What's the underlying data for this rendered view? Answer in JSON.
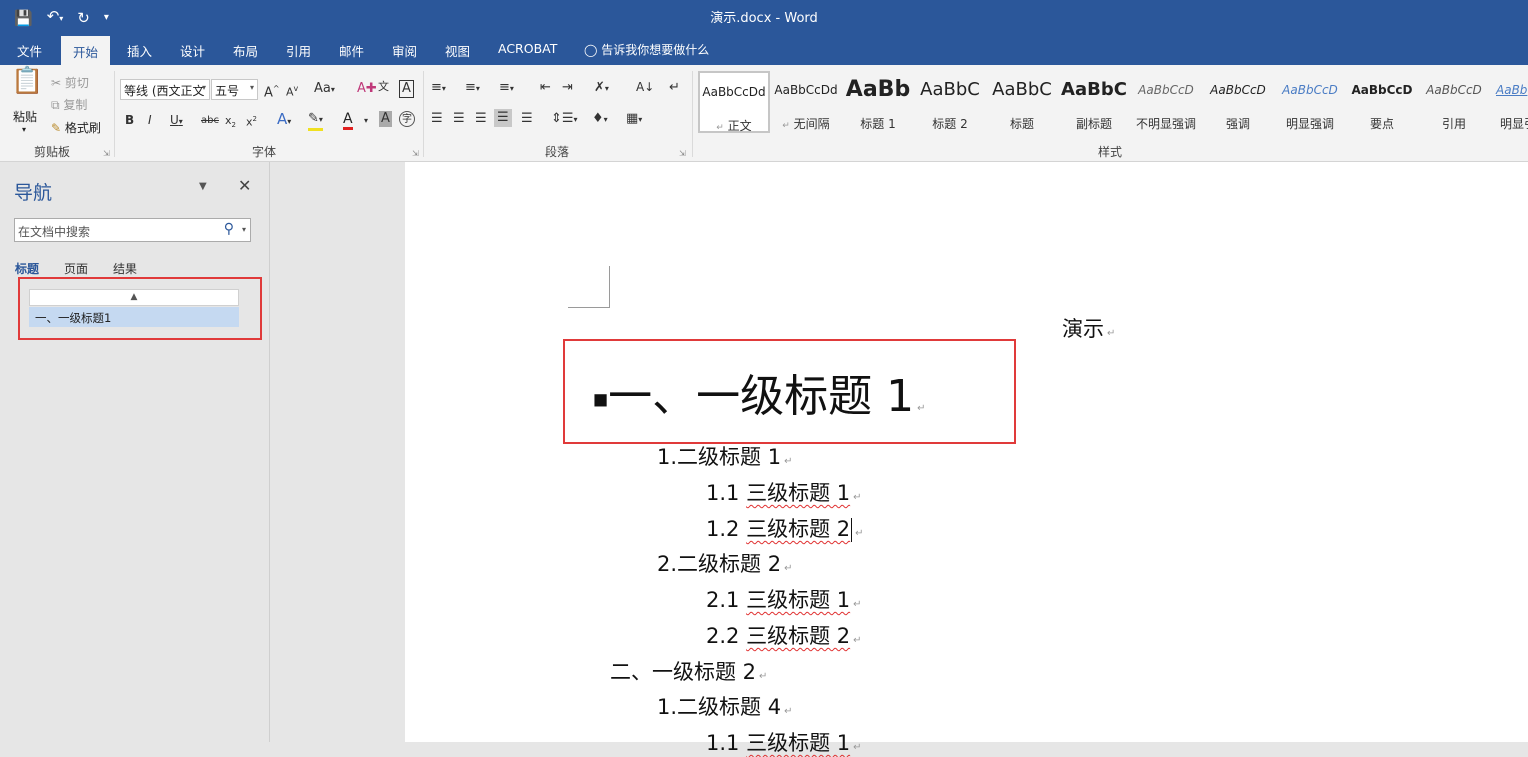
{
  "window": {
    "title": "演示.docx  -  Word"
  },
  "tabs": [
    "文件",
    "开始",
    "插入",
    "设计",
    "布局",
    "引用",
    "邮件",
    "审阅",
    "视图",
    "ACROBAT"
  ],
  "tell_me": "告诉我你想要做什么",
  "clipboard": {
    "paste": "粘贴",
    "cut": "剪切",
    "copy": "复制",
    "format_painter": "格式刷",
    "group": "剪贴板"
  },
  "font": {
    "name": "等线 (西文正文",
    "size": "五号",
    "group": "字体"
  },
  "paragraph": {
    "group": "段落"
  },
  "styles": {
    "group": "样式",
    "items": [
      {
        "preview": "AaBbCcDd",
        "name": "正文"
      },
      {
        "preview": "AaBbCcDd",
        "name": "无间隔"
      },
      {
        "preview": "AaBb",
        "name": "标题 1"
      },
      {
        "preview": "AaBbC",
        "name": "标题 2"
      },
      {
        "preview": "AaBbC",
        "name": "标题"
      },
      {
        "preview": "AaBbC",
        "name": "副标题"
      },
      {
        "preview": "AaBbCcD",
        "name": "不明显强调"
      },
      {
        "preview": "AaBbCcD",
        "name": "强调"
      },
      {
        "preview": "AaBbCcD",
        "name": "明显强调"
      },
      {
        "preview": "AaBbCcD",
        "name": "要点"
      },
      {
        "preview": "AaBbCcD",
        "name": "引用"
      },
      {
        "preview": "AaBb",
        "name": "明显引"
      }
    ]
  },
  "nav": {
    "title": "导航",
    "search_placeholder": "在文档中搜索",
    "tabs": [
      "标题",
      "页面",
      "结果"
    ],
    "heading": "一、一级标题1"
  },
  "doc": {
    "title": "演示",
    "h1": "一、一级标题 1",
    "l1": "1.二级标题 1",
    "l2a": "1.1 ",
    "l2b": "三级标题 1",
    "l3a": "1.2 ",
    "l3b": "三级标题 2",
    "l4": "2.二级标题 2",
    "l5a": "2.1 ",
    "l5b": "三级标题 1",
    "l6a": "2.2 ",
    "l6b": "三级标题 2",
    "l7": "二、一级标题 2",
    "l8": "1.二级标题 4",
    "l9a": "1.1 ",
    "l9b": "三级标题 1"
  },
  "colors": {
    "accent": "#2b579a",
    "highlight_box": "#e03a3a",
    "nav_selected": "#c5d9f1"
  }
}
